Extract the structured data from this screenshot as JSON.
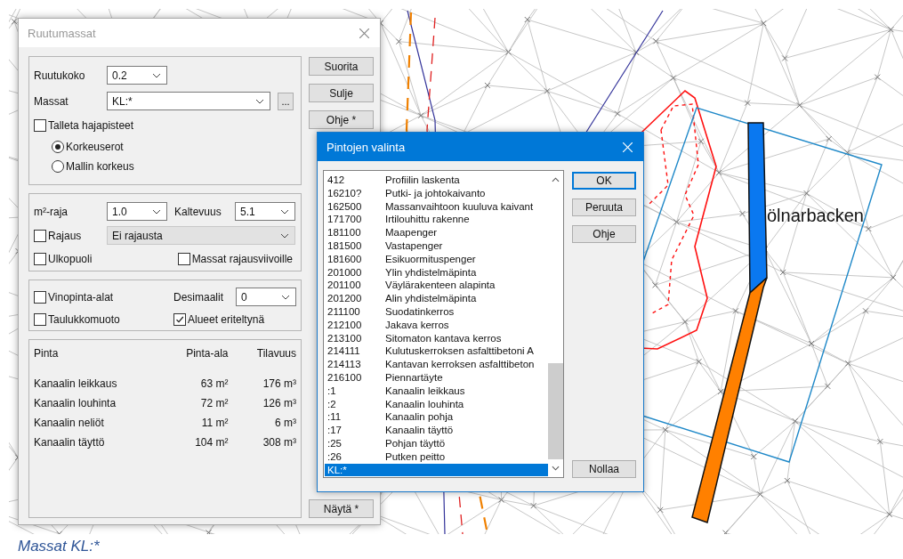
{
  "map": {
    "place_label": "ölnarbacken"
  },
  "main_dialog": {
    "title": "Ruutumassat",
    "grid_size": {
      "label": "Ruutukoko",
      "value": "0.2"
    },
    "masses": {
      "label": "Massat",
      "value": "KL:*",
      "browse_button": "..."
    },
    "save_points": {
      "label": "Talleta hajapisteet",
      "checked": false
    },
    "height_mode": [
      {
        "label": "Korkeuserot",
        "selected": true
      },
      {
        "label": "Mallin korkeus",
        "selected": false
      }
    ],
    "area_limit": {
      "label": "m²-raja",
      "value": "1.0"
    },
    "slope": {
      "label": "Kaltevuus",
      "value": "5.1"
    },
    "clipping": {
      "label": "Rajaus",
      "checked": false
    },
    "clipping_mode": {
      "value": "Ei rajausta",
      "disabled": true
    },
    "outside": {
      "label": "Ulkopuoli",
      "checked": false
    },
    "boundary_masses": {
      "label": "Massat rajausviivoille",
      "checked": false
    },
    "slope_areas": {
      "label": "Vinopinta-alat",
      "checked": false
    },
    "decimals": {
      "label": "Desimaalit",
      "value": "0"
    },
    "table_format": {
      "label": "Taulukkomuoto",
      "checked": false
    },
    "separate_areas": {
      "label": "Alueet eriteltynä",
      "checked": true
    },
    "results": {
      "columns": [
        "Pinta",
        "Pinta-ala",
        "Tilavuus"
      ],
      "rows": [
        [
          "Kanaalin leikkaus",
          "63 m²",
          "176 m³"
        ],
        [
          "Kanaalin louhinta",
          "72 m²",
          "126 m³"
        ],
        [
          "Kanaalin neliöt",
          "11 m²",
          "6 m³"
        ],
        [
          "Kanaalin täyttö",
          "104 m²",
          "308 m³"
        ]
      ]
    },
    "buttons": [
      "Suorita",
      "Sulje",
      "Ohje *"
    ],
    "bottom_button": "Näytä *"
  },
  "surface_dialog": {
    "title": "Pintojen valinta",
    "items": [
      {
        "code": "412",
        "name": "Profiilin laskenta",
        "selected": false
      },
      {
        "code": "16210?",
        "name": "Putki- ja johtokaivanto",
        "selected": false
      },
      {
        "code": "162500",
        "name": "Massanvaihtoon kuuluva kaivant",
        "selected": false
      },
      {
        "code": "171700",
        "name": "Irtilouhittu rakenne",
        "selected": false
      },
      {
        "code": "181100",
        "name": "Maapenger",
        "selected": false
      },
      {
        "code": "181500",
        "name": "Vastapenger",
        "selected": false
      },
      {
        "code": "181600",
        "name": "Esikuormituspenger",
        "selected": false
      },
      {
        "code": "201000",
        "name": "Ylin yhdistelmäpinta",
        "selected": false
      },
      {
        "code": "201100",
        "name": "Väylärakenteen alapinta",
        "selected": false
      },
      {
        "code": "201200",
        "name": "Alin yhdistelmäpinta",
        "selected": false
      },
      {
        "code": "211100",
        "name": "Suodatinkerros",
        "selected": false
      },
      {
        "code": "212100",
        "name": "Jakava kerros",
        "selected": false
      },
      {
        "code": "213100",
        "name": "Sitomaton kantava kerros",
        "selected": false
      },
      {
        "code": "214111",
        "name": "Kulutuskerroksen asfalttibetoni A",
        "selected": false
      },
      {
        "code": "214113",
        "name": "Kantavan kerroksen asfalttibeton",
        "selected": false
      },
      {
        "code": "216100",
        "name": "Piennartäyte",
        "selected": false
      },
      {
        "code": ":1",
        "name": "Kanaalin leikkaus",
        "selected": false
      },
      {
        "code": ":2",
        "name": "Kanaalin louhinta",
        "selected": false
      },
      {
        "code": ":11",
        "name": "Kanaalin pohja",
        "selected": false
      },
      {
        "code": ":17",
        "name": "Kanaalin täyttö",
        "selected": false
      },
      {
        "code": ":25",
        "name": "Pohjan täyttö",
        "selected": false
      },
      {
        "code": ":26",
        "name": "Putken peitto",
        "selected": false
      },
      {
        "code": "KL:*",
        "selected": true
      }
    ],
    "buttons": [
      {
        "label": "OK",
        "default": true
      },
      {
        "label": "Peruuta",
        "default": false
      },
      {
        "label": "Ohje",
        "default": false
      }
    ],
    "reset_button": "Nollaa"
  },
  "caption": "Massat KL:*"
}
